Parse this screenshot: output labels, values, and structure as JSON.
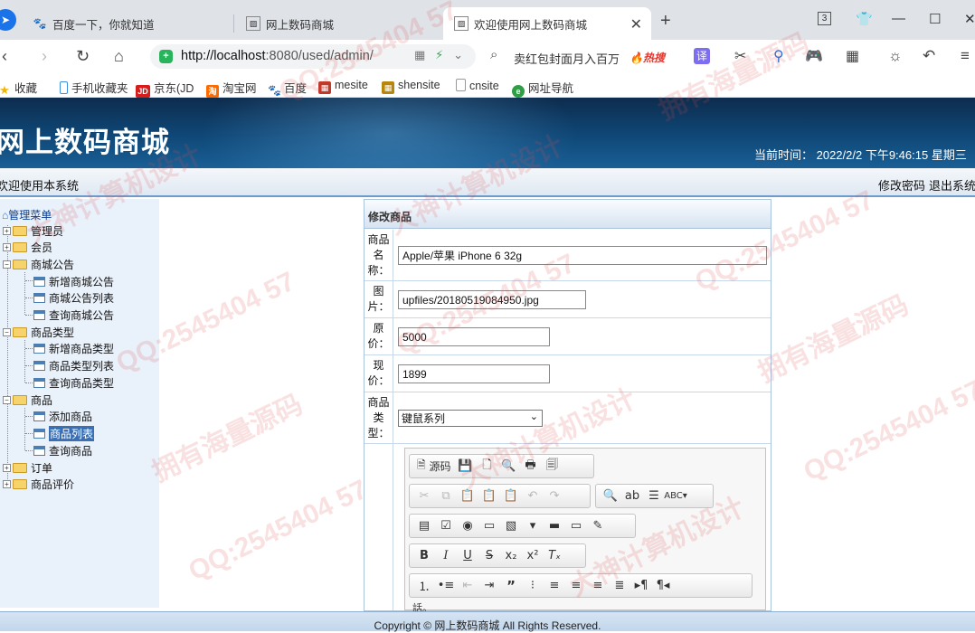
{
  "browser": {
    "tabs": [
      {
        "title": "百度一下，你就知道",
        "icon": "baidu-paw-icon"
      },
      {
        "title": "网上数码商城",
        "icon": "image-icon"
      },
      {
        "title": "欢迎使用网上数码商城",
        "icon": "image-icon"
      }
    ],
    "tab_count_badge": "3",
    "url_host": "http://localhost",
    "url_rest": ":8080/used/admin/",
    "search_text": "卖红包封面月入百万",
    "search_hot": "热搜",
    "bookmarks": [
      {
        "label": "收藏",
        "icon": "star-icon"
      },
      {
        "label": "手机收藏夹",
        "icon": "phone-icon"
      },
      {
        "label": "京东(JD",
        "icon": "jd-icon"
      },
      {
        "label": "淘宝网",
        "icon": "taobao-icon"
      },
      {
        "label": "百度",
        "icon": "baidu-paw-icon"
      },
      {
        "label": "mesite",
        "icon": "grid-icon"
      },
      {
        "label": "shensite",
        "icon": "grid-icon"
      },
      {
        "label": "cnsite",
        "icon": "document-icon"
      },
      {
        "label": "网址导航",
        "icon": "navigation-icon"
      }
    ]
  },
  "header": {
    "title": "网上数码商城",
    "time": "当前时间： 2022/2/2 下午9:46:15 星期三",
    "welcome": "欢迎使用本系统",
    "links": [
      "修改密码",
      "退出系统"
    ]
  },
  "sidebar": {
    "root": "管理菜单",
    "items": [
      {
        "label": "管理员",
        "type": "folder",
        "level": 0,
        "expanded": false
      },
      {
        "label": "会员",
        "type": "folder",
        "level": 0,
        "expanded": false
      },
      {
        "label": "商城公告",
        "type": "folder",
        "level": 0,
        "expanded": true
      },
      {
        "label": "新增商城公告",
        "type": "page",
        "level": 1
      },
      {
        "label": "商城公告列表",
        "type": "page",
        "level": 1
      },
      {
        "label": "查询商城公告",
        "type": "page",
        "level": 1
      },
      {
        "label": "商品类型",
        "type": "folder",
        "level": 0,
        "expanded": true
      },
      {
        "label": "新增商品类型",
        "type": "page",
        "level": 1
      },
      {
        "label": "商品类型列表",
        "type": "page",
        "level": 1
      },
      {
        "label": "查询商品类型",
        "type": "page",
        "level": 1
      },
      {
        "label": "商品",
        "type": "folder",
        "level": 0,
        "expanded": true
      },
      {
        "label": "添加商品",
        "type": "page",
        "level": 1
      },
      {
        "label": "商品列表",
        "type": "page",
        "level": 1,
        "selected": true
      },
      {
        "label": "查询商品",
        "type": "page",
        "level": 1
      },
      {
        "label": "订单",
        "type": "folder",
        "level": 0,
        "expanded": false
      },
      {
        "label": "商品评价",
        "type": "folder",
        "level": 0,
        "expanded": false
      }
    ]
  },
  "form": {
    "title": "修改商品",
    "fields": {
      "name": {
        "label": "商品名称：",
        "value": "Apple/苹果 iPhone 6 32g"
      },
      "image": {
        "label": "图片：",
        "value": "upfiles/20180519084950.jpg"
      },
      "orig_price": {
        "label": "原价：",
        "value": "5000"
      },
      "price": {
        "label": "现价：",
        "value": "1899"
      },
      "category": {
        "label": "商品类型：",
        "value": "键鼠系列"
      }
    },
    "editor": {
      "source_label": "源码",
      "partial_text": "話。"
    }
  },
  "footer": {
    "copyright": "Copyright © 网上数码商城 All Rights Reserved."
  },
  "watermarks": [
    "QQ:2545404 57",
    "大神计算机设计",
    "拥有海量源码"
  ]
}
